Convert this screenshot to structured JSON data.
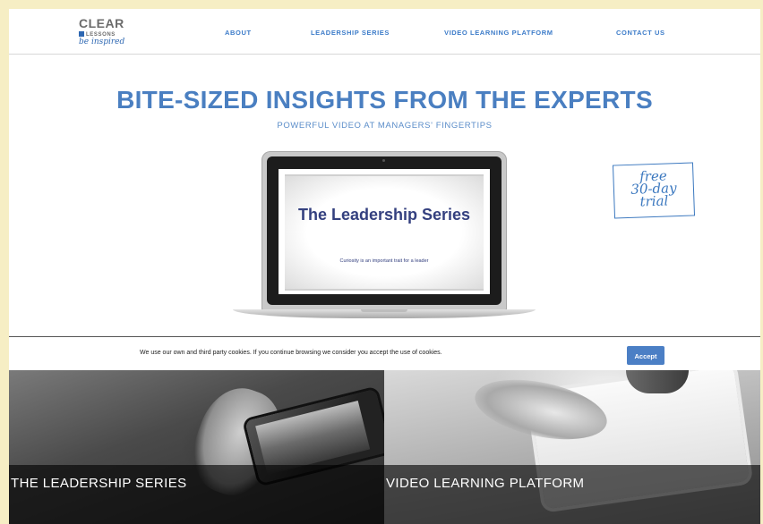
{
  "brand": {
    "name": "CLEAR",
    "sub": "LESSONS",
    "tagline": "be inspired",
    "accent_color": "#2d67b2"
  },
  "nav": {
    "items": [
      "ABOUT",
      "LEADERSHIP SERIES",
      "VIDEO LEARNING PLATFORM",
      "CONTACT US"
    ]
  },
  "hero": {
    "title": "BITE-SIZED INSIGHTS FROM THE EXPERTS",
    "subtitle": "POWERFUL VIDEO AT MANAGERS' FINGERTIPS"
  },
  "laptop_screen": {
    "title": "The Leadership Series",
    "caption": "Curiosity is an important trait for a leader"
  },
  "promo_stamp": {
    "line1": "free",
    "line2": "30-day",
    "line3": "trial"
  },
  "cookie_bar": {
    "text": "We use our own and third party cookies. If you continue browsing we consider you accept the use of cookies.",
    "accept_label": "Accept"
  },
  "tiles": [
    {
      "label": "THE LEADERSHIP SERIES",
      "image_icon": "hand-holding-phone-photo"
    },
    {
      "label": "VIDEO LEARNING PLATFORM",
      "image_icon": "hand-touching-tablet-photo"
    }
  ],
  "colors": {
    "background": "#f6eec4",
    "link": "#3d7cc9",
    "hero_title": "#4a7fc1",
    "button": "#4b7fc5"
  }
}
